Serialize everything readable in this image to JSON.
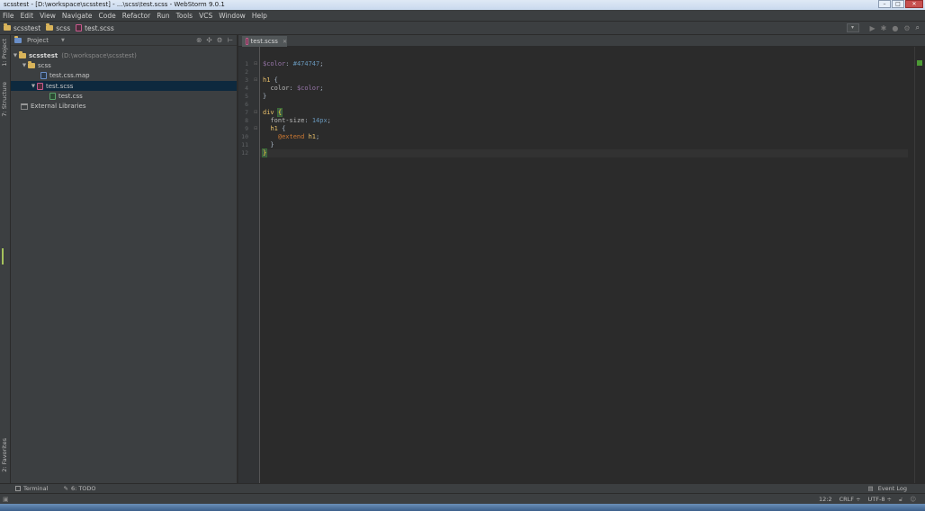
{
  "window": {
    "title": "scsstest - [D:\\workspace\\scsstest] - ...\\scss\\test.scss - WebStorm 9.0.1"
  },
  "menu": [
    "File",
    "Edit",
    "View",
    "Navigate",
    "Code",
    "Refactor",
    "Run",
    "Tools",
    "VCS",
    "Window",
    "Help"
  ],
  "breadcrumb": [
    "scsstest",
    "scss",
    "test.scss"
  ],
  "left_stripe": {
    "project_tab": "1: Project",
    "structure_tab": "7: Structure",
    "favorites_tab": "2: Favorites"
  },
  "project_panel": {
    "view_label": "Project",
    "tree": {
      "root": {
        "name": "scsstest",
        "path": "(D:\\workspace\\scsstest)"
      },
      "scss_folder": "scss",
      "map_file": "test.css.map",
      "scss_file": "test.scss",
      "css_file": "test.css",
      "external": "External Libraries"
    }
  },
  "editor": {
    "tab_label": "test.scss",
    "line_numbers": [
      "1",
      "2",
      "3",
      "4",
      "5",
      "6",
      "7",
      "8",
      "9",
      "10",
      "11",
      "12"
    ]
  },
  "bottom_tools": {
    "terminal": "Terminal",
    "todo": "6: TODO",
    "event_log": "Event Log"
  },
  "status": {
    "caret": "12:2",
    "line_sep": "CRLF ÷",
    "encoding": "UTF-8 ÷"
  }
}
